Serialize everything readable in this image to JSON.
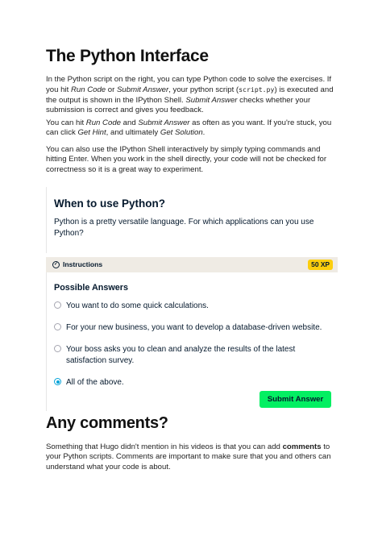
{
  "document": {
    "title": "The Python Interface",
    "p1": {
      "t1": "In the Python script on the right, you can type Python code to solve the exercises. If you hit ",
      "run_code": "Run Code",
      "t2": " or ",
      "submit_answer": "Submit Answer",
      "t3": ", your python script (",
      "script_file": "script.py",
      "t4": ") is executed and the output is shown in the IPython Shell. ",
      "submit_answer_2": "Submit Answer",
      "t5": " checks whether your submission is correct and gives you feedback."
    },
    "p2": {
      "t1": "You can hit ",
      "run_code": "Run Code",
      "t2": " and ",
      "submit_answer": "Submit Answer",
      "t3": " as often as you want. If you're stuck, you can click ",
      "get_hint": "Get Hint",
      "t4": ", and ultimately ",
      "get_solution": "Get Solution",
      "t5": "."
    },
    "p3": "You can also use the IPython Shell interactively by simply typing commands and hitting Enter. When you work in the shell directly, your code will not be checked for correctness so it is a great way to experiment.",
    "section2_title": "Any comments?",
    "p4": {
      "t1": "Something that Hugo didn't mention in his videos is that you can add ",
      "comments": "comments",
      "t2": " to your Python scripts. Comments are important to make sure that you and others can understand what your code is about."
    }
  },
  "exercise": {
    "title": "When to use Python?",
    "description": "Python is a pretty versatile language. For which applications can you use Python?",
    "instructions_label": "Instructions",
    "xp_badge": "50 XP",
    "answers_title": "Possible Answers",
    "options": [
      {
        "label": "You want to do some quick calculations.",
        "selected": false
      },
      {
        "label": "For your new business, you want to develop a database-driven website.",
        "selected": false
      },
      {
        "label": "Your boss asks you to clean and analyze the results of the latest satisfaction survey.",
        "selected": false
      },
      {
        "label": "All of the above.",
        "selected": true
      }
    ],
    "submit_label": "Submit Answer"
  },
  "colors": {
    "navy": "#05192d",
    "submit_green": "#03ef62",
    "xp_yellow": "#fcce0d",
    "instructions_bg": "#efebe4",
    "radio_selected": "#03a2d8"
  },
  "icons": {
    "instructions": "check-circle-icon"
  }
}
